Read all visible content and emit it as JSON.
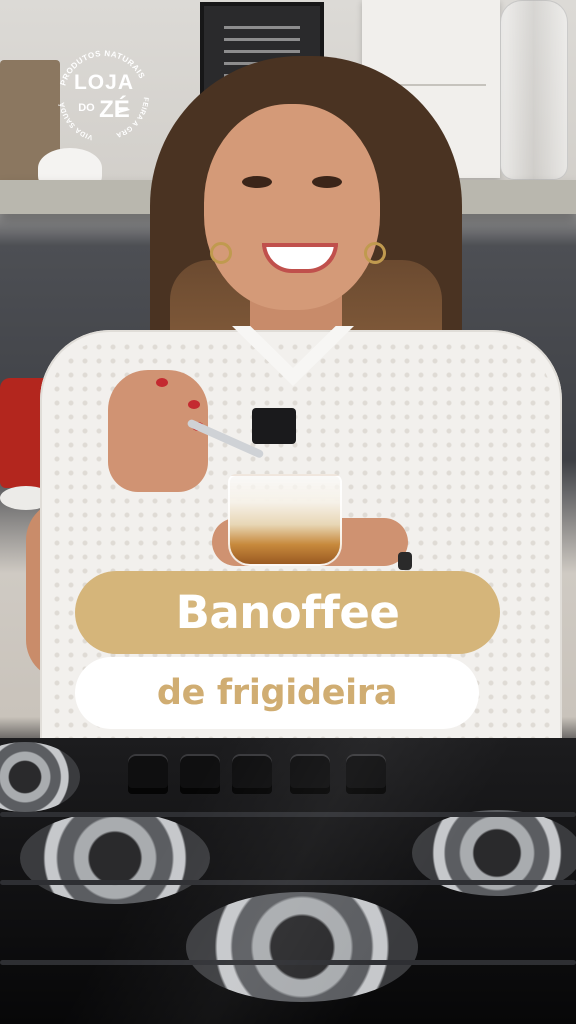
{
  "logo": {
    "name_line1": "LOJA",
    "name_do": "DO",
    "name_ze": "ZÉ",
    "ring_top": "PRODUTOS NATURAIS",
    "ring_right": "FEIRA A GRANEL",
    "ring_left": "VIDA SAUDÁVEL",
    "color": "#ffffff"
  },
  "title": {
    "main": "Banoffee",
    "subtitle": "de frigideira"
  },
  "colors": {
    "accent_gold": "#d5b57a",
    "subtitle_text": "#d0ad72",
    "white": "#ffffff"
  }
}
